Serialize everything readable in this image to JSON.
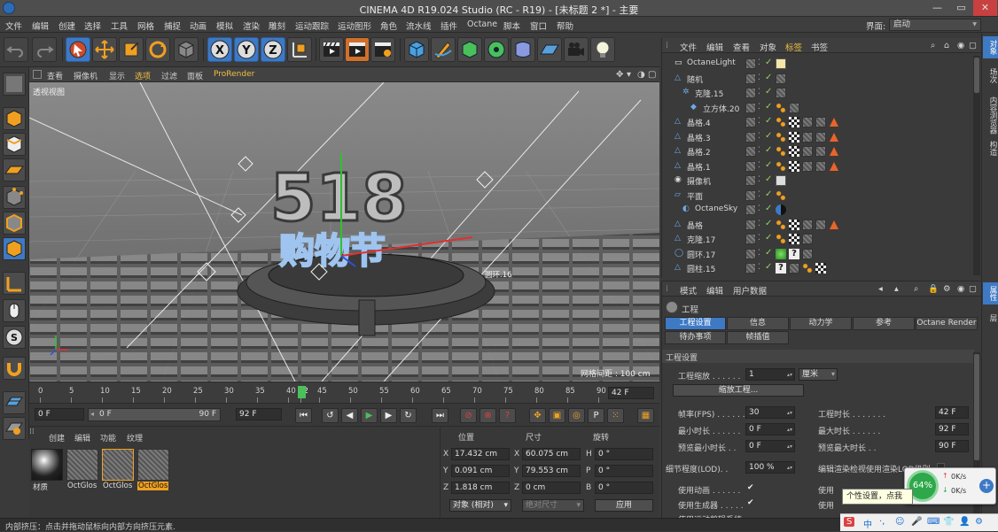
{
  "window": {
    "title": "CINEMA 4D R19.024 Studio (RC - R19) - [未标题 2 *] - 主要",
    "min": "—",
    "max": "▭",
    "close": "✕"
  },
  "menu": [
    "文件",
    "编辑",
    "创建",
    "选择",
    "工具",
    "网格",
    "捕捉",
    "动画",
    "模拟",
    "渲染",
    "雕刻",
    "运动跟踪",
    "运动图形",
    "角色",
    "流水线",
    "插件",
    "Octane",
    "脚本",
    "窗口",
    "帮助"
  ],
  "interface": {
    "label": "界面:",
    "value": "启动"
  },
  "viewport": {
    "menu": [
      "查看",
      "摄像机",
      "显示",
      "选项",
      "过滤",
      "面板",
      "ProRender"
    ],
    "label": "透视视图",
    "grid_info": "网格间距 : 100 cm",
    "scene_text_top": "518",
    "scene_text_bottom": "购物节",
    "object_tag": "圆环.16"
  },
  "timeline": {
    "ticks": [
      "0",
      "5",
      "10",
      "15",
      "20",
      "25",
      "30",
      "35",
      "40",
      "42",
      "45",
      "50",
      "55",
      "60",
      "65",
      "70",
      "75",
      "80",
      "85",
      "90"
    ],
    "current": "42",
    "end_field": "42 F"
  },
  "transport": {
    "start": "0 F",
    "slider_start": "0 F",
    "slider_end": "90 F",
    "end": "92 F"
  },
  "materials": {
    "menu": [
      "创建",
      "编辑",
      "功能",
      "纹理"
    ],
    "items": [
      "材质",
      "OctGlos",
      "OctGlos",
      "OctGlos"
    ]
  },
  "coords": {
    "headers": [
      "位置",
      "尺寸",
      "旋转"
    ],
    "rows": [
      {
        "axis": "X",
        "pos": "17.432 cm",
        "size_axis": "X",
        "size": "60.075 cm",
        "rot_axis": "H",
        "rot": "0 °"
      },
      {
        "axis": "Y",
        "pos": "0.091 cm",
        "size_axis": "Y",
        "size": "79.553 cm",
        "rot_axis": "P",
        "rot": "0 °"
      },
      {
        "axis": "Z",
        "pos": "1.818 cm",
        "size_axis": "Z",
        "size": "0 cm",
        "rot_axis": "B",
        "rot": "0 °"
      }
    ],
    "mode": "对象 (相对)",
    "size_mode": "绝对尺寸",
    "apply": "应用"
  },
  "objects": {
    "menu": [
      "文件",
      "编辑",
      "查看",
      "对象",
      "标签",
      "书签"
    ],
    "rows": [
      {
        "name": "OctaneLight",
        "indent": 0
      },
      {
        "name": "随机",
        "indent": 0
      },
      {
        "name": "克隆.15",
        "indent": 1
      },
      {
        "name": "立方体.20",
        "indent": 2
      },
      {
        "name": "晶格.4",
        "indent": 0
      },
      {
        "name": "晶格.3",
        "indent": 0
      },
      {
        "name": "晶格.2",
        "indent": 0
      },
      {
        "name": "晶格.1",
        "indent": 0
      },
      {
        "name": "摄像机",
        "indent": 0
      },
      {
        "name": "平面",
        "indent": 0
      },
      {
        "name": "OctaneSky",
        "indent": 1
      },
      {
        "name": "晶格",
        "indent": 0
      },
      {
        "name": "克隆.17",
        "indent": 0
      },
      {
        "name": "圆环.17",
        "indent": 0
      },
      {
        "name": "圆柱.15",
        "indent": 0
      }
    ]
  },
  "attributes": {
    "menu": [
      "模式",
      "编辑",
      "用户数据"
    ],
    "title": "工程",
    "tabs_row1": [
      "工程设置",
      "信息",
      "动力学",
      "参考",
      "Octane Render"
    ],
    "tabs_row2": [
      "待办事项",
      "帧插值"
    ],
    "section": "工程设置",
    "scale_label": "工程缩放 . . . . . .",
    "scale_value": "1",
    "scale_unit": "厘米",
    "scale_button": "缩放工程...",
    "fps_label": "帧率(FPS) . . . . . .",
    "fps_value": "30",
    "project_len_label": "工程时长 . . . . . . .",
    "project_len_value": "42 F",
    "min_len_label": "最小时长 . . . . . .",
    "min_len_value": "0 F",
    "max_len_label": "最大时长 . . . . . .",
    "max_len_value": "92 F",
    "preview_min_label": "预览最小时长 . .",
    "preview_min_value": "0 F",
    "preview_max_label": "预览最大时长 . .",
    "preview_max_value": "90 F",
    "lod_label": "细节程度(LOD). .",
    "lod_value": "100 %",
    "lod_render_label": "编辑渲染检视使用渲染LOD级别",
    "use_anim_label": "使用动画 . . . . . .",
    "use_gen_label": "使用生成器 . . . . .",
    "use_deform_label": "使用运动剪辑系统",
    "use_right1": "使用",
    "use_right2": "使用"
  },
  "right_tabs": [
    "对象",
    "场次",
    "内容浏览器",
    "构造",
    "属性",
    "层"
  ],
  "status": "内部挤压：点击并拖动鼠标向内部方向挤压元素.",
  "net": {
    "percent": "64%",
    "up": "0K/s",
    "down": "0K/s"
  },
  "tooltip": "个性设置，点我",
  "ime": [
    "S",
    "中",
    "·,",
    "☺",
    "🎤",
    "⌨",
    "👕",
    "👤",
    "⚙"
  ],
  "colors": {
    "accent": "#3e79c4",
    "orange": "#e68a1e",
    "bg": "#3a3a3a"
  }
}
